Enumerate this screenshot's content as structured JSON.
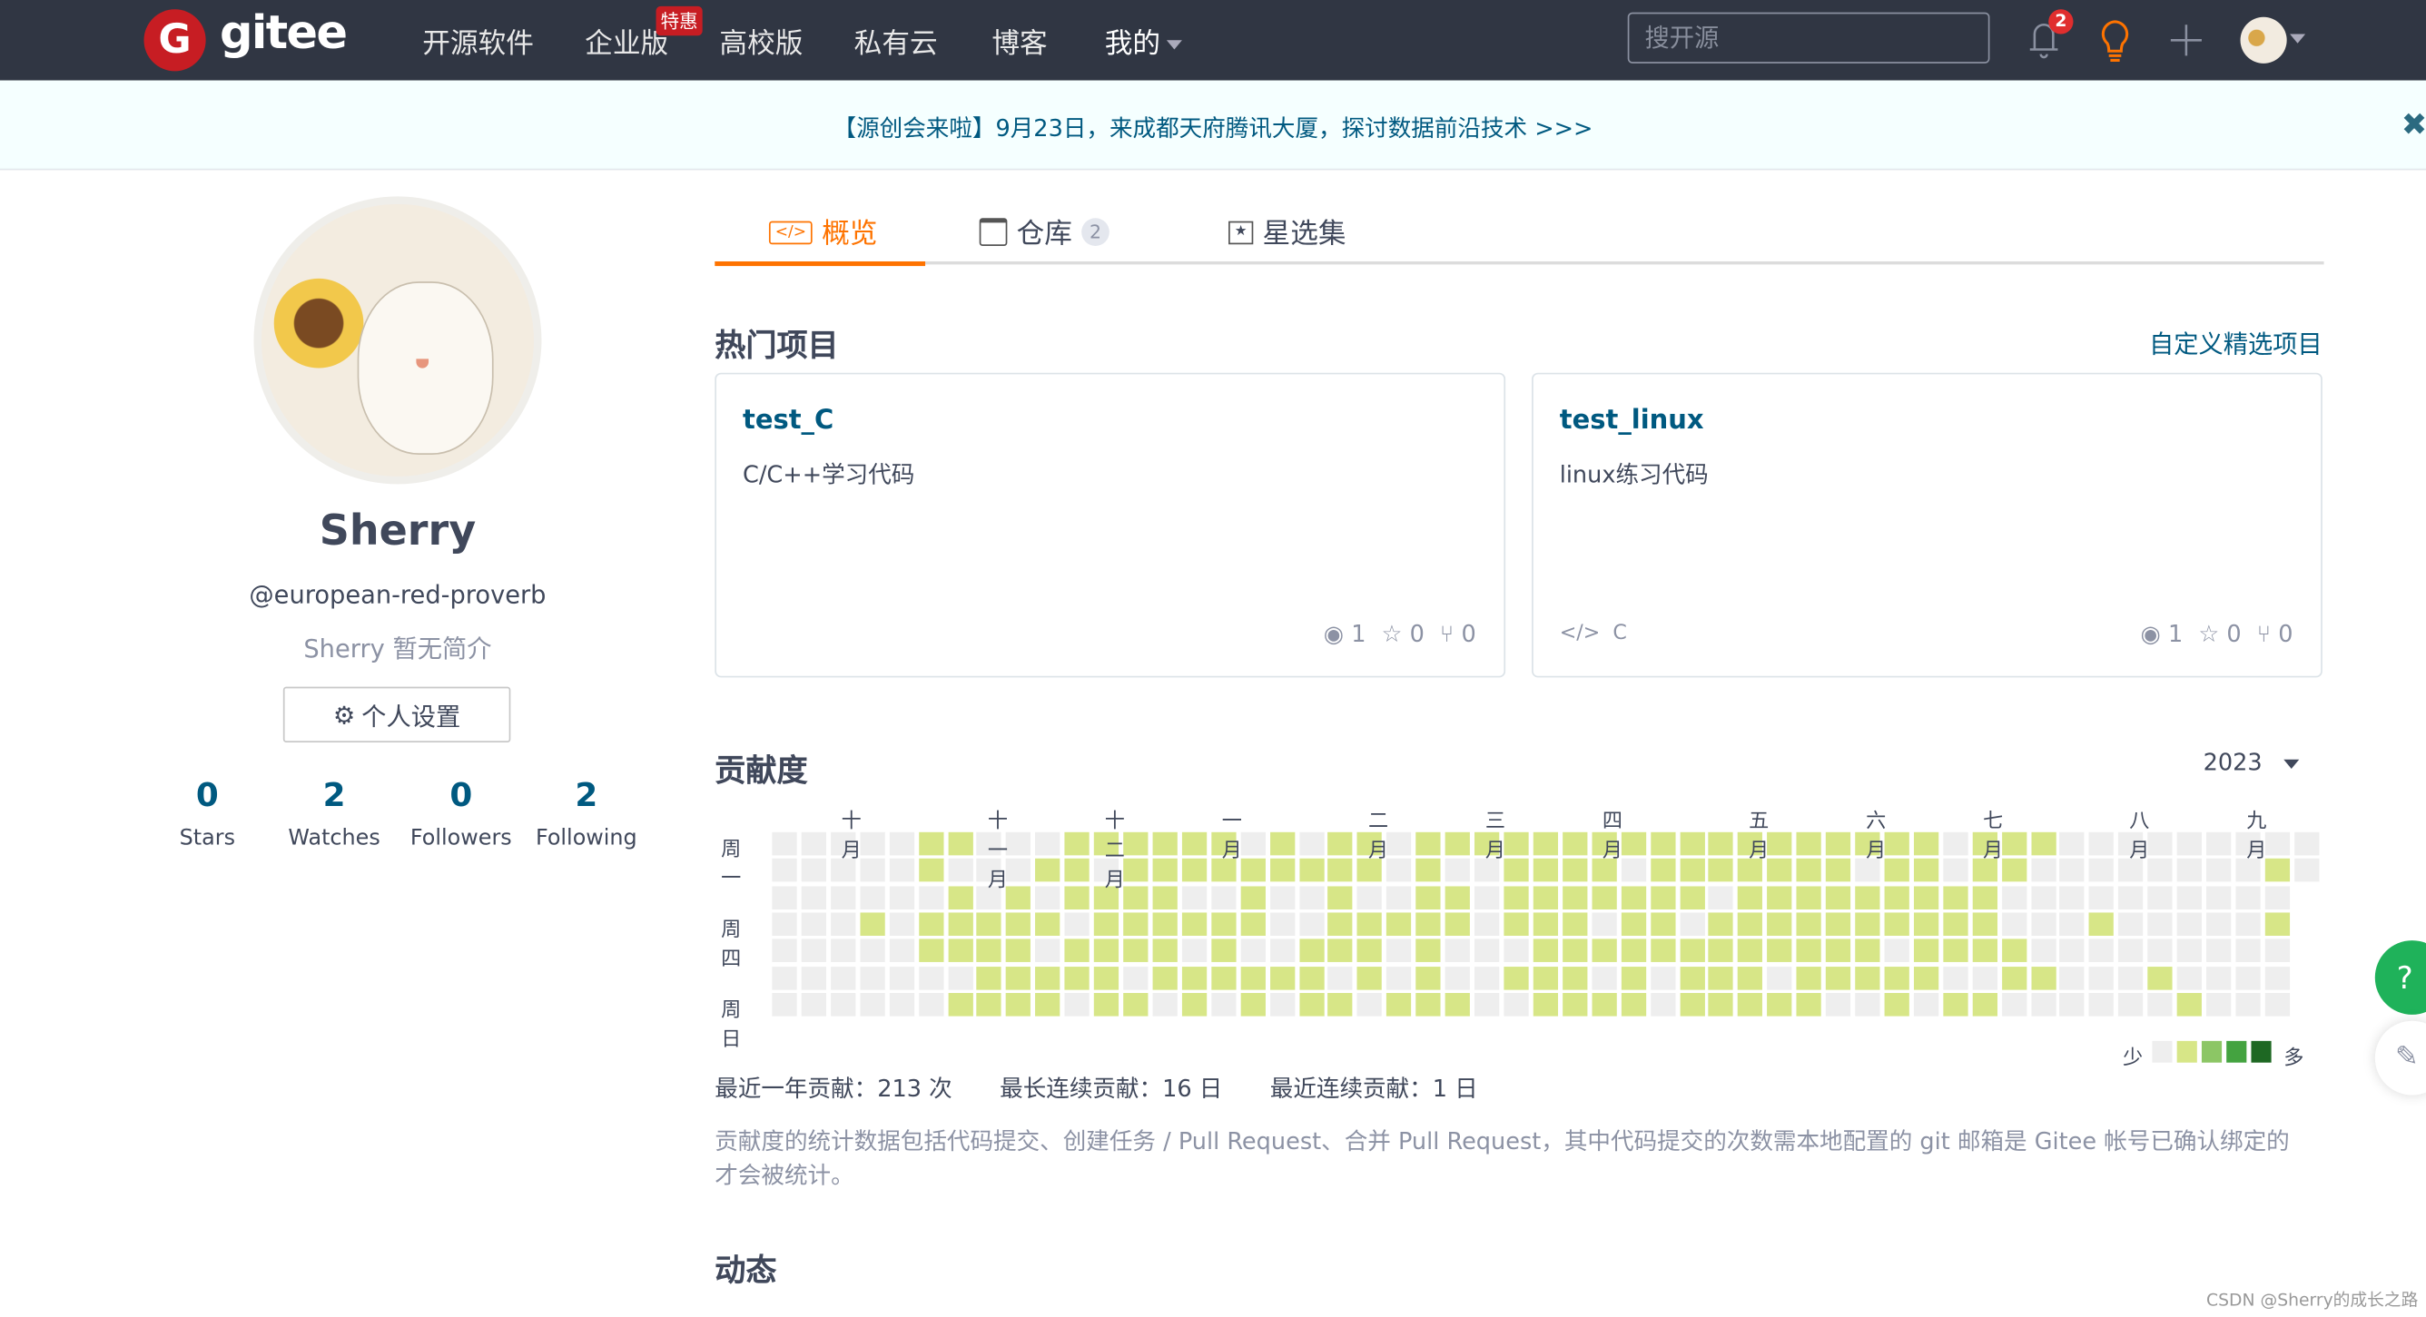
{
  "header": {
    "logo_text": "gitee",
    "logo_letter": "G",
    "nav": [
      "开源软件",
      "企业版",
      "高校版",
      "私有云",
      "博客",
      "我的"
    ],
    "enterprise_badge": "特惠",
    "search_placeholder": "搜开源",
    "notification_count": "2"
  },
  "banner": {
    "text": "【源创会来啦】9月23日，来成都天府腾讯大厦，探讨数据前沿技术 >>>",
    "close": "✖"
  },
  "profile": {
    "name": "Sherry",
    "login": "@european-red-proverb",
    "bio": "Sherry 暂无简介",
    "settings_label": "个人设置",
    "stats": [
      {
        "value": "0",
        "label": "Stars"
      },
      {
        "value": "2",
        "label": "Watches"
      },
      {
        "value": "0",
        "label": "Followers"
      },
      {
        "value": "2",
        "label": "Following"
      }
    ]
  },
  "tabs": [
    {
      "label": "概览",
      "active": true
    },
    {
      "label": "仓库",
      "count": "2"
    },
    {
      "label": "星选集"
    }
  ],
  "popular": {
    "title": "热门项目",
    "customize_link": "自定义精选项目",
    "projects": [
      {
        "name": "test_C",
        "desc": "C/C++学习代码",
        "lang": "",
        "watch": "1",
        "star": "0",
        "fork": "0"
      },
      {
        "name": "test_linux",
        "desc": "linux练习代码",
        "lang": "C",
        "watch": "1",
        "star": "0",
        "fork": "0"
      }
    ]
  },
  "contrib": {
    "title": "贡献度",
    "year": "2023",
    "legend_less": "少",
    "legend_more": "多",
    "summary": [
      "最近一年贡献：213 次",
      "最长连续贡献：16 日",
      "最近连续贡献：1 日"
    ],
    "note": "贡献度的统计数据包括代码提交、创建任务 / Pull Request、合并 Pull Request，其中代码提交的次数需本地配置的 git 邮箱是 Gitee 帐号已确认绑定的才会被统计。"
  },
  "activity_title": "动态",
  "watermark": "CSDN @Sherry的成长之路",
  "chart_data": {
    "type": "heatmap",
    "day_labels": [
      "周一",
      "",
      "",
      "周四",
      "",
      "",
      "周日"
    ],
    "months": [
      {
        "label": "十月",
        "col": 3
      },
      {
        "label": "十一月",
        "col": 8
      },
      {
        "label": "十二月",
        "col": 12
      },
      {
        "label": "一月",
        "col": 16
      },
      {
        "label": "二月",
        "col": 21
      },
      {
        "label": "三月",
        "col": 25
      },
      {
        "label": "四月",
        "col": 29
      },
      {
        "label": "五月",
        "col": 34
      },
      {
        "label": "六月",
        "col": 38
      },
      {
        "label": "七月",
        "col": 42
      },
      {
        "label": "八月",
        "col": 47
      },
      {
        "label": "九月",
        "col": 51
      }
    ],
    "levels_colors": [
      "#eeeeee",
      "#d7e687",
      "#8cc665",
      "#44a340",
      "#1e6823"
    ],
    "rows": [
      "00000110001111110101101111111111111111110111000000000",
      "00000100011011111111101001111011111110110110000000010",
      "0000001010111100100100110111111101111111110000000000-",
      "0001011111011111100111110111011011111111110001000001-",
      "0000011110111101001110100011111111111101111000000000-",
      "0000000111110111111010100111010111011111001100010000-",
      "0000001111011010101101110011110111110010110000001000-"
    ]
  }
}
